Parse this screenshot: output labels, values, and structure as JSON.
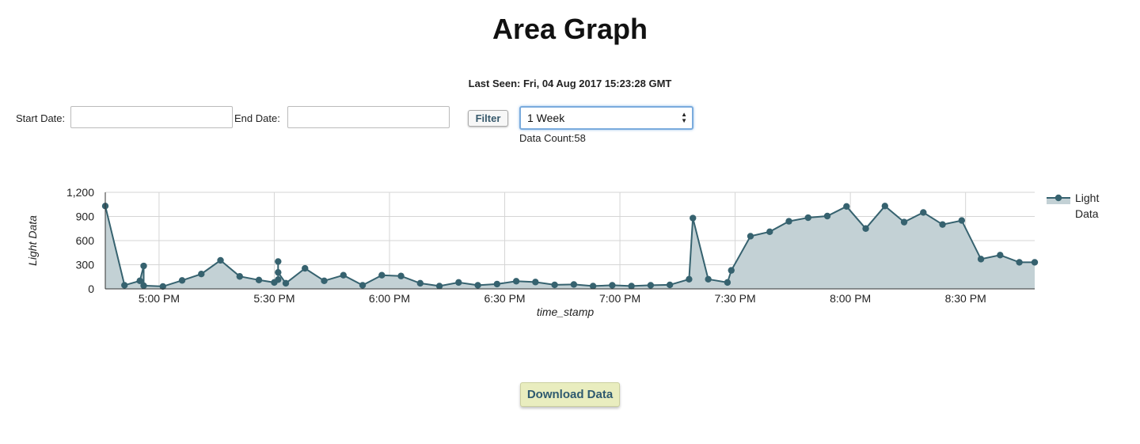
{
  "page": {
    "title": "Area Graph",
    "last_seen": "Last Seen: Fri, 04 Aug 2017 15:23:28 GMT"
  },
  "filters": {
    "start_label": "Start Date:",
    "start_value": "",
    "end_label": "End Date:",
    "end_value": "",
    "filter_button": "Filter",
    "range_selected": "1 Week",
    "data_count": "Data Count:58"
  },
  "download": {
    "label": "Download Data"
  },
  "colors": {
    "series": "#36626f",
    "fill": "#c3d1d5",
    "grid": "#d5d5d5",
    "button_bg": "#e9edbf"
  },
  "chart_data": {
    "type": "area",
    "xlabel": "time_stamp",
    "ylabel": "Light Data",
    "ylim": [
      0,
      1200
    ],
    "yticks": [
      0,
      300,
      600,
      900,
      1200
    ],
    "ytick_labels": [
      "0",
      "300",
      "600",
      "900",
      "1,200"
    ],
    "xlim": [
      "16:46",
      "20:48"
    ],
    "xticks": [
      "17:00",
      "17:30",
      "18:00",
      "18:30",
      "19:00",
      "19:30",
      "20:00",
      "20:30"
    ],
    "xtick_labels": [
      "5:00 PM",
      "5:30 PM",
      "6:00 PM",
      "6:30 PM",
      "7:00 PM",
      "7:30 PM",
      "8:00 PM",
      "8:30 PM"
    ],
    "grid": true,
    "legend": "right",
    "series": [
      {
        "name": "Light Data",
        "points": [
          [
            "16:46",
            1030
          ],
          [
            "16:51",
            45
          ],
          [
            "16:55",
            100
          ],
          [
            "16:56",
            285
          ],
          [
            "16:56",
            40
          ],
          [
            "17:01",
            30
          ],
          [
            "17:06",
            105
          ],
          [
            "17:11",
            185
          ],
          [
            "17:16",
            355
          ],
          [
            "17:21",
            155
          ],
          [
            "17:26",
            110
          ],
          [
            "17:30",
            80
          ],
          [
            "17:31",
            115
          ],
          [
            "17:31",
            340
          ],
          [
            "17:31",
            205
          ],
          [
            "17:33",
            70
          ],
          [
            "17:38",
            255
          ],
          [
            "17:43",
            100
          ],
          [
            "17:48",
            170
          ],
          [
            "17:53",
            45
          ],
          [
            "17:58",
            170
          ],
          [
            "18:03",
            160
          ],
          [
            "18:08",
            70
          ],
          [
            "18:13",
            35
          ],
          [
            "18:18",
            80
          ],
          [
            "18:23",
            45
          ],
          [
            "18:28",
            60
          ],
          [
            "18:33",
            95
          ],
          [
            "18:38",
            85
          ],
          [
            "18:43",
            50
          ],
          [
            "18:48",
            55
          ],
          [
            "18:53",
            35
          ],
          [
            "18:58",
            45
          ],
          [
            "19:03",
            35
          ],
          [
            "19:08",
            45
          ],
          [
            "19:13",
            50
          ],
          [
            "19:18",
            120
          ],
          [
            "19:19",
            880
          ],
          [
            "19:23",
            120
          ],
          [
            "19:28",
            80
          ],
          [
            "19:29",
            230
          ],
          [
            "19:34",
            655
          ],
          [
            "19:39",
            710
          ],
          [
            "19:44",
            840
          ],
          [
            "19:49",
            885
          ],
          [
            "19:54",
            905
          ],
          [
            "19:59",
            1025
          ],
          [
            "20:04",
            750
          ],
          [
            "20:09",
            1030
          ],
          [
            "20:14",
            830
          ],
          [
            "20:19",
            950
          ],
          [
            "20:24",
            800
          ],
          [
            "20:29",
            850
          ],
          [
            "20:34",
            370
          ],
          [
            "20:39",
            420
          ],
          [
            "20:44",
            330
          ],
          [
            "20:48",
            330
          ]
        ]
      }
    ]
  }
}
